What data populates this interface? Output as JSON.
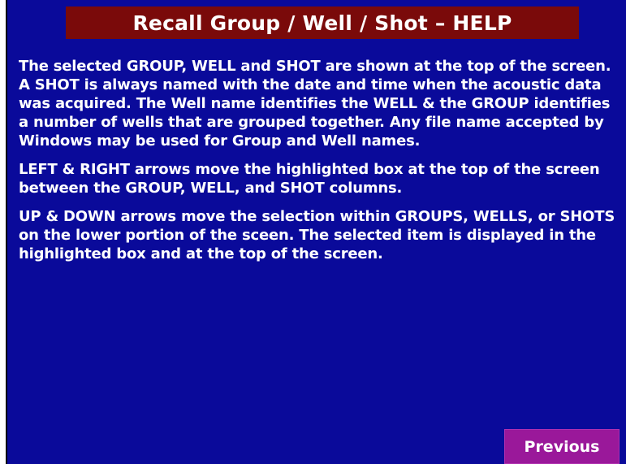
{
  "header": {
    "title": "Recall Group / Well / Shot – HELP"
  },
  "help": {
    "paragraphs": [
      "The selected GROUP, WELL and SHOT are shown at the top of the screen.  A SHOT is always named with the date and time when the acoustic data was acquired. The Well name identifies the WELL & the GROUP identifies a number of wells that are grouped together.  Any file name accepted by Windows may be used for Group and Well names.",
      "LEFT & RIGHT arrows move the highlighted box at the top of the screen between the GROUP, WELL, and SHOT columns.",
      "UP & DOWN arrows move the selection within GROUPS, WELLS, or SHOTS on the lower portion of the sceen.  The selected item is displayed in the highlighted box and at the top of the screen."
    ]
  },
  "footer": {
    "previous_label": "Previous"
  },
  "colors": {
    "background": "#0a0a9a",
    "title_bar": "#7a0a0a",
    "button": "#9a189a",
    "text": "#ffffff"
  }
}
